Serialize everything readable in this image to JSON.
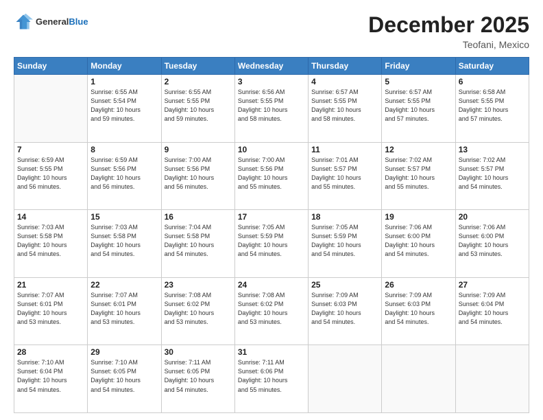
{
  "header": {
    "logo_general": "General",
    "logo_blue": "Blue",
    "month": "December 2025",
    "location": "Teofani, Mexico"
  },
  "weekdays": [
    "Sunday",
    "Monday",
    "Tuesday",
    "Wednesday",
    "Thursday",
    "Friday",
    "Saturday"
  ],
  "weeks": [
    [
      {
        "day": "",
        "info": ""
      },
      {
        "day": "1",
        "info": "Sunrise: 6:55 AM\nSunset: 5:54 PM\nDaylight: 10 hours\nand 59 minutes."
      },
      {
        "day": "2",
        "info": "Sunrise: 6:55 AM\nSunset: 5:55 PM\nDaylight: 10 hours\nand 59 minutes."
      },
      {
        "day": "3",
        "info": "Sunrise: 6:56 AM\nSunset: 5:55 PM\nDaylight: 10 hours\nand 58 minutes."
      },
      {
        "day": "4",
        "info": "Sunrise: 6:57 AM\nSunset: 5:55 PM\nDaylight: 10 hours\nand 58 minutes."
      },
      {
        "day": "5",
        "info": "Sunrise: 6:57 AM\nSunset: 5:55 PM\nDaylight: 10 hours\nand 57 minutes."
      },
      {
        "day": "6",
        "info": "Sunrise: 6:58 AM\nSunset: 5:55 PM\nDaylight: 10 hours\nand 57 minutes."
      }
    ],
    [
      {
        "day": "7",
        "info": "Sunrise: 6:59 AM\nSunset: 5:55 PM\nDaylight: 10 hours\nand 56 minutes."
      },
      {
        "day": "8",
        "info": "Sunrise: 6:59 AM\nSunset: 5:56 PM\nDaylight: 10 hours\nand 56 minutes."
      },
      {
        "day": "9",
        "info": "Sunrise: 7:00 AM\nSunset: 5:56 PM\nDaylight: 10 hours\nand 56 minutes."
      },
      {
        "day": "10",
        "info": "Sunrise: 7:00 AM\nSunset: 5:56 PM\nDaylight: 10 hours\nand 55 minutes."
      },
      {
        "day": "11",
        "info": "Sunrise: 7:01 AM\nSunset: 5:57 PM\nDaylight: 10 hours\nand 55 minutes."
      },
      {
        "day": "12",
        "info": "Sunrise: 7:02 AM\nSunset: 5:57 PM\nDaylight: 10 hours\nand 55 minutes."
      },
      {
        "day": "13",
        "info": "Sunrise: 7:02 AM\nSunset: 5:57 PM\nDaylight: 10 hours\nand 54 minutes."
      }
    ],
    [
      {
        "day": "14",
        "info": "Sunrise: 7:03 AM\nSunset: 5:58 PM\nDaylight: 10 hours\nand 54 minutes."
      },
      {
        "day": "15",
        "info": "Sunrise: 7:03 AM\nSunset: 5:58 PM\nDaylight: 10 hours\nand 54 minutes."
      },
      {
        "day": "16",
        "info": "Sunrise: 7:04 AM\nSunset: 5:58 PM\nDaylight: 10 hours\nand 54 minutes."
      },
      {
        "day": "17",
        "info": "Sunrise: 7:05 AM\nSunset: 5:59 PM\nDaylight: 10 hours\nand 54 minutes."
      },
      {
        "day": "18",
        "info": "Sunrise: 7:05 AM\nSunset: 5:59 PM\nDaylight: 10 hours\nand 54 minutes."
      },
      {
        "day": "19",
        "info": "Sunrise: 7:06 AM\nSunset: 6:00 PM\nDaylight: 10 hours\nand 54 minutes."
      },
      {
        "day": "20",
        "info": "Sunrise: 7:06 AM\nSunset: 6:00 PM\nDaylight: 10 hours\nand 53 minutes."
      }
    ],
    [
      {
        "day": "21",
        "info": "Sunrise: 7:07 AM\nSunset: 6:01 PM\nDaylight: 10 hours\nand 53 minutes."
      },
      {
        "day": "22",
        "info": "Sunrise: 7:07 AM\nSunset: 6:01 PM\nDaylight: 10 hours\nand 53 minutes."
      },
      {
        "day": "23",
        "info": "Sunrise: 7:08 AM\nSunset: 6:02 PM\nDaylight: 10 hours\nand 53 minutes."
      },
      {
        "day": "24",
        "info": "Sunrise: 7:08 AM\nSunset: 6:02 PM\nDaylight: 10 hours\nand 53 minutes."
      },
      {
        "day": "25",
        "info": "Sunrise: 7:09 AM\nSunset: 6:03 PM\nDaylight: 10 hours\nand 54 minutes."
      },
      {
        "day": "26",
        "info": "Sunrise: 7:09 AM\nSunset: 6:03 PM\nDaylight: 10 hours\nand 54 minutes."
      },
      {
        "day": "27",
        "info": "Sunrise: 7:09 AM\nSunset: 6:04 PM\nDaylight: 10 hours\nand 54 minutes."
      }
    ],
    [
      {
        "day": "28",
        "info": "Sunrise: 7:10 AM\nSunset: 6:04 PM\nDaylight: 10 hours\nand 54 minutes."
      },
      {
        "day": "29",
        "info": "Sunrise: 7:10 AM\nSunset: 6:05 PM\nDaylight: 10 hours\nand 54 minutes."
      },
      {
        "day": "30",
        "info": "Sunrise: 7:11 AM\nSunset: 6:05 PM\nDaylight: 10 hours\nand 54 minutes."
      },
      {
        "day": "31",
        "info": "Sunrise: 7:11 AM\nSunset: 6:06 PM\nDaylight: 10 hours\nand 55 minutes."
      },
      {
        "day": "",
        "info": ""
      },
      {
        "day": "",
        "info": ""
      },
      {
        "day": "",
        "info": ""
      }
    ]
  ]
}
